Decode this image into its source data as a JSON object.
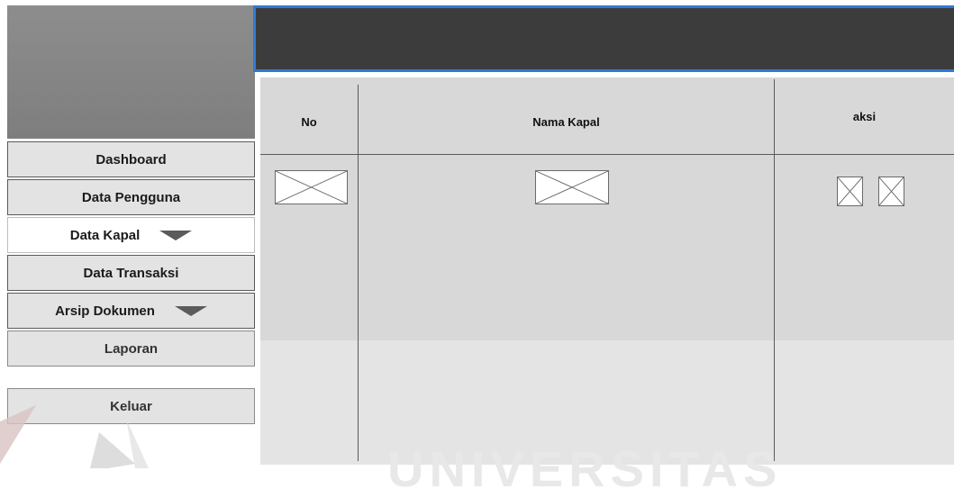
{
  "sidebar": {
    "items": [
      {
        "label": "Dashboard"
      },
      {
        "label": "Data Pengguna"
      },
      {
        "label": "Data Kapal"
      },
      {
        "label": "Data Transaksi"
      },
      {
        "label": "Arsip Dokumen"
      },
      {
        "label": "Laporan"
      },
      {
        "label": "Keluar"
      }
    ],
    "active_item": "Data Kapal",
    "dropdown_icon": "triangle-down-icon"
  },
  "table": {
    "headers": [
      "No",
      "Nama Kapal",
      "aksi"
    ],
    "rows": [
      {
        "no": "image-placeholder",
        "nama_kapal": "image-placeholder",
        "aksi": [
          "image-placeholder",
          "image-placeholder"
        ]
      }
    ]
  },
  "watermark": {
    "text": "UNIVERSITAS"
  },
  "colors": {
    "header_bg": "#3c3c3c",
    "header_border": "#2f7ad6",
    "sidebar_logo_bg": "#888888",
    "table_bg": "#d8d8d8",
    "nav_bg": "#e3e3e3",
    "nav_active_bg": "#ffffff",
    "watermark_accent": "#c0392b"
  }
}
